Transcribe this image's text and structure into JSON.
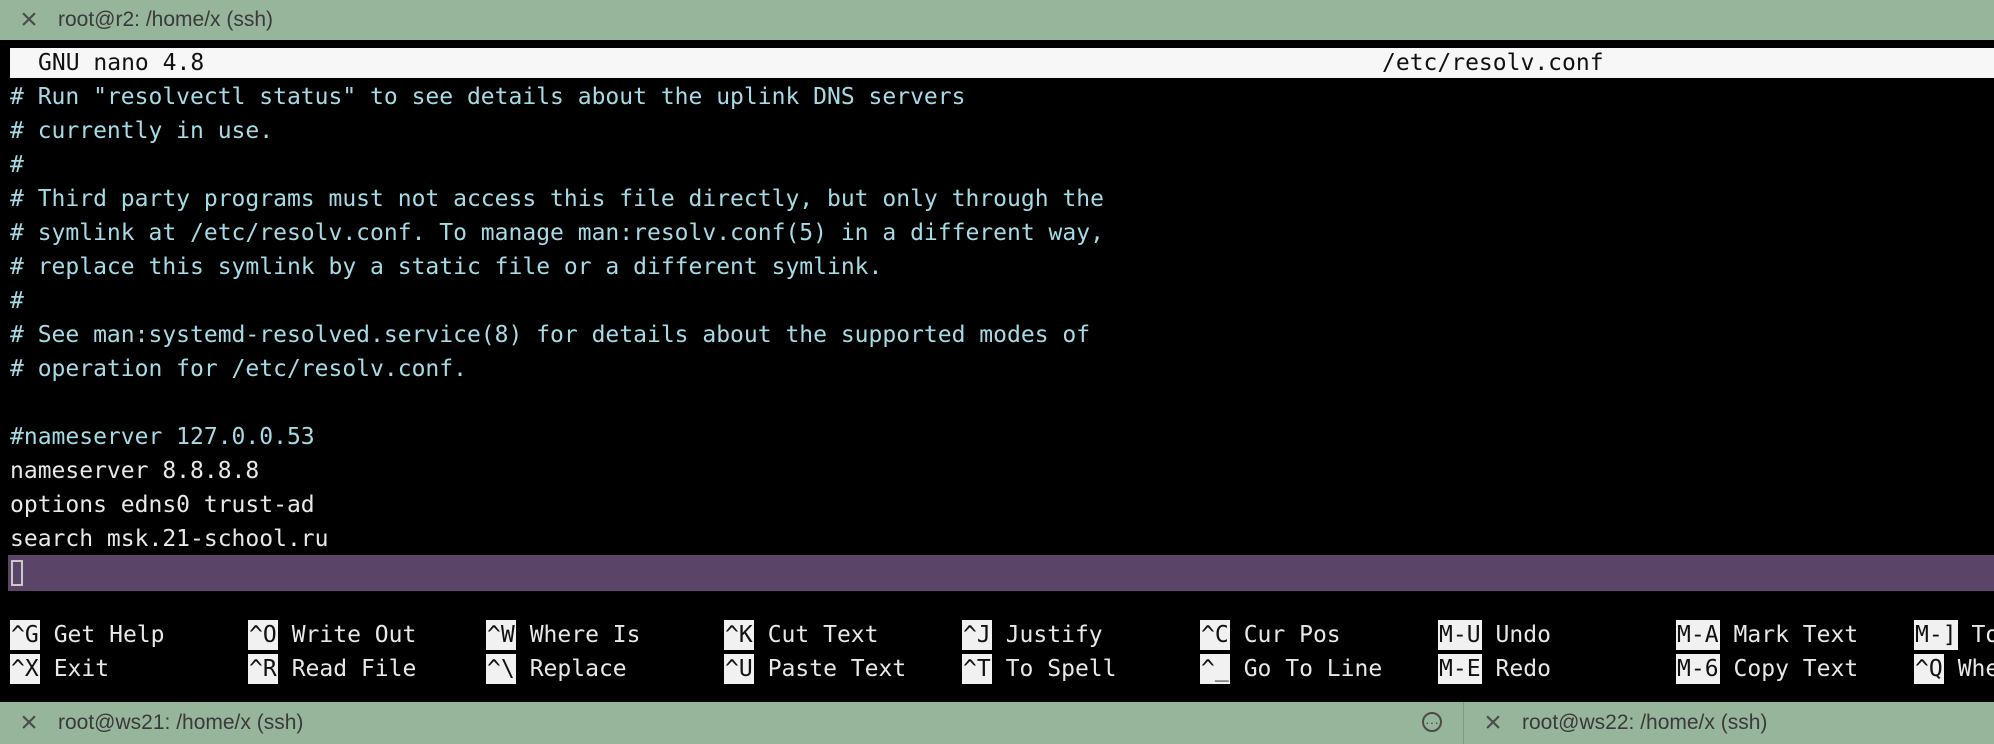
{
  "tabs": {
    "top": {
      "title": "root@r2: /home/x (ssh)"
    },
    "bottom": [
      {
        "title": "root@ws21: /home/x (ssh)"
      },
      {
        "title": "root@ws22: /home/x (ssh)"
      }
    ]
  },
  "editor": {
    "version": "GNU nano 4.8",
    "filename": "/etc/resolv.conf",
    "lines": [
      {
        "text": "# Run \"resolvectl status\" to see details about the uplink DNS servers",
        "kind": "comment"
      },
      {
        "text": "# currently in use.",
        "kind": "comment"
      },
      {
        "text": "#",
        "kind": "comment"
      },
      {
        "text": "# Third party programs must not access this file directly, but only through the",
        "kind": "comment"
      },
      {
        "text": "# symlink at /etc/resolv.conf. To manage man:resolv.conf(5) in a different way,",
        "kind": "comment"
      },
      {
        "text": "# replace this symlink by a static file or a different symlink.",
        "kind": "comment"
      },
      {
        "text": "#",
        "kind": "comment"
      },
      {
        "text": "# See man:systemd-resolved.service(8) for details about the supported modes of",
        "kind": "comment"
      },
      {
        "text": "# operation for /etc/resolv.conf.",
        "kind": "comment"
      },
      {
        "text": "",
        "kind": "code"
      },
      {
        "text": "#nameserver 127.0.0.53",
        "kind": "comment"
      },
      {
        "text": "nameserver 8.8.8.8",
        "kind": "code"
      },
      {
        "text": "options edns0 trust-ad",
        "kind": "code"
      },
      {
        "text": "search msk.21-school.ru",
        "kind": "code"
      }
    ]
  },
  "shortcuts": [
    {
      "key": "^G",
      "label": "Get Help"
    },
    {
      "key": "^X",
      "label": "Exit"
    },
    {
      "key": "^O",
      "label": "Write Out"
    },
    {
      "key": "^R",
      "label": "Read File"
    },
    {
      "key": "^W",
      "label": "Where Is"
    },
    {
      "key": "^\\",
      "label": "Replace"
    },
    {
      "key": "^K",
      "label": "Cut Text"
    },
    {
      "key": "^U",
      "label": "Paste Text"
    },
    {
      "key": "^J",
      "label": "Justify"
    },
    {
      "key": "^T",
      "label": "To Spell"
    },
    {
      "key": "^C",
      "label": "Cur Pos"
    },
    {
      "key": "^_",
      "label": "Go To Line"
    },
    {
      "key": "M-U",
      "label": "Undo"
    },
    {
      "key": "M-E",
      "label": "Redo"
    },
    {
      "key": "M-A",
      "label": "Mark Text"
    },
    {
      "key": "M-6",
      "label": "Copy Text"
    },
    {
      "key": "M-]",
      "label": "To"
    },
    {
      "key": "^Q",
      "label": "Whe"
    }
  ],
  "colors": {
    "tabbar": "#97b59a",
    "header_bg": "#f7f7f7",
    "status_bar": "#5a4569",
    "comment_text": "#a6dbe6",
    "code_text": "#e8e8e8"
  },
  "icons": {
    "close": "close-icon",
    "more": "more-icon"
  }
}
